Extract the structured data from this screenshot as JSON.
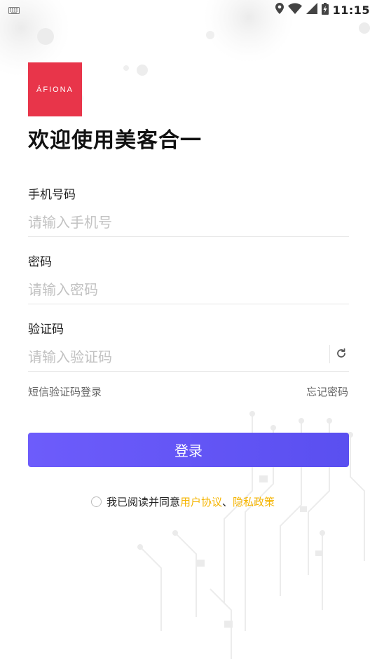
{
  "status_bar": {
    "time": "11:15",
    "icons": [
      "keyboard-icon",
      "location-icon",
      "wifi-icon",
      "signal-icon",
      "battery-charging-icon"
    ]
  },
  "logo": {
    "text": "ÁFIONA",
    "color": "#e8354a"
  },
  "welcome_title": "欢迎使用美客合一",
  "form": {
    "phone": {
      "label": "手机号码",
      "placeholder": "请输入手机号",
      "value": ""
    },
    "password": {
      "label": "密码",
      "placeholder": "请输入密码",
      "value": ""
    },
    "code": {
      "label": "验证码",
      "placeholder": "请输入验证码",
      "value": "",
      "refresh_icon": "refresh-icon"
    }
  },
  "links": {
    "sms_login": "短信验证码登录",
    "forgot_password": "忘记密码"
  },
  "login_button": {
    "label": "登录",
    "color": "#5e52f5"
  },
  "agreement": {
    "prefix": "我已阅读并同意",
    "user_agreement": "用户协议",
    "separator": "、",
    "privacy_policy": "隐私政策",
    "link_color": "#f5b400",
    "checked": false
  }
}
